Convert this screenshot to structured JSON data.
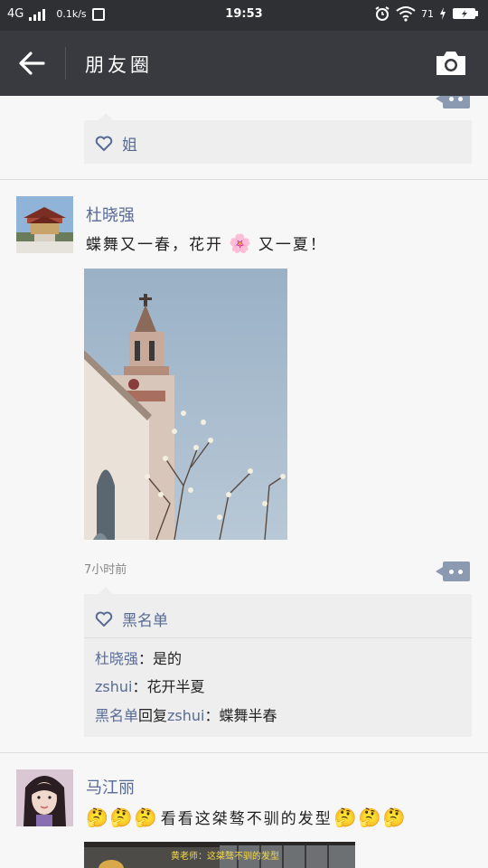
{
  "statusbar": {
    "network": "4G",
    "speed": "0.1k/s",
    "time": "19:53",
    "battery_pct": "71"
  },
  "appbar": {
    "title": "朋友圈"
  },
  "posts": [
    {
      "likes": "姐"
    },
    {
      "author": "杜晓强",
      "text_part1": "蝶舞又一春，花开",
      "text_part2": "又一夏！",
      "emoji": "🌸",
      "time": "7小时前",
      "likes": "黑名单",
      "comments": [
        {
          "author": "杜晓强",
          "sep": "：",
          "text": "是的"
        },
        {
          "author": "zshui",
          "sep": "：",
          "text": "花开半夏"
        },
        {
          "author": "黑名单",
          "mid": "回复",
          "target": "zshui",
          "sep": "：",
          "text": "蝶舞半春"
        }
      ]
    },
    {
      "author": "马江丽",
      "emoji": "🤔",
      "text": "看看这桀骜不驯的发型",
      "image_caption": "黄老师：这桀骜不驯的发型"
    }
  ],
  "colors": {
    "link": "#576b95",
    "appbar": "#393a3f",
    "statusbar": "#2e3033"
  }
}
